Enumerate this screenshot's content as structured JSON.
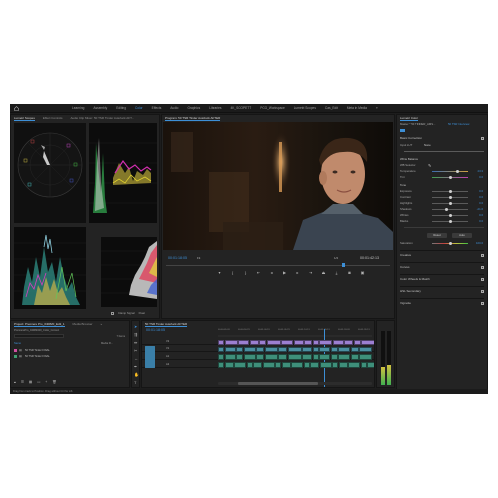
{
  "workspace": {
    "tabs": [
      "Learning",
      "Assembly",
      "Editing",
      "Color",
      "Effects",
      "Audio",
      "Graphics",
      "Libraries",
      "4K_SCOPETT",
      "PCG_Workspace",
      "Lumetri Scopes",
      "Cas_Edit",
      "Meta in Media",
      "»"
    ],
    "active": "Color"
  },
  "scopes_panel": {
    "tabs": [
      "Lumetri Scopes",
      "Effect Controls",
      "Audio Clip Mixer: 50 TSR Tinder Autofuck AFT..."
    ],
    "footer_checkbox": "Clamp Signal",
    "footer_value": "Float"
  },
  "program": {
    "title": "Program: 50 TSR Tinder Autofuck AFTER",
    "timecode_left": "00:01:18:05",
    "fit_label": "Fit",
    "ratio": "1/2",
    "timecode_right": "00:01:42:13"
  },
  "lumetri": {
    "title": "Lumetri Color",
    "master_label": "Master * 50 TINDER_AMS...",
    "master_seq": "50 TSR Interview",
    "basic_correction": "Basic Correction",
    "input_lut_label": "Input LUT",
    "input_lut_value": "None",
    "white_balance": "White Balance",
    "wb_selector": "WB Selector",
    "temperature_label": "Temperature",
    "temperature": "23.3",
    "tint_label": "Tint",
    "tint": "0.0",
    "tone": "Tone",
    "exposure_label": "Exposure",
    "exposure": "0.0",
    "contrast_label": "Contrast",
    "contrast": "0.0",
    "highlights_label": "Highlights",
    "highlights": "0.0",
    "shadows_label": "Shadows",
    "shadows": "-21.0",
    "whites_label": "Whites",
    "whites": "0.0",
    "blacks_label": "Blacks",
    "blacks": "0.0",
    "reset": "Reset",
    "auto": "Auto",
    "saturation_label": "Saturation",
    "saturation": "100.0",
    "sections": [
      "Creative",
      "Curves",
      "Color Wheels & Match",
      "HSL Secondary",
      "Vignette"
    ]
  },
  "project": {
    "tabs": [
      "Project: Premiere Pro_040820_Edit_1",
      "Media Browser",
      "»"
    ],
    "path": "PremierePro_04082020_Color_Correct",
    "count": "7 Items",
    "col_name": "Name",
    "col_rate": "Media Fl...",
    "items": [
      "50 TSR Tinder FINAL",
      "50 TSR Tinder FINAL"
    ]
  },
  "timeline": {
    "tab": "50 TSR Tinder Autofuck AFTER",
    "timecode": "00:01:18:05",
    "ruler": [
      "00:00:45:03",
      "00:00:50:23",
      "00:01:00:19",
      "00:01:05:23",
      "00:01:14:13",
      "00:01:20:13",
      "00:01:24:03",
      "00:01:26:13"
    ],
    "tracks": [
      "V2",
      "V1",
      "A1",
      "A2"
    ]
  },
  "status_bar": "Drag from track to Position. Drag without Ctrl for Lift.",
  "colors": {
    "accent": "#3d8fd6",
    "clip_purple": "#9c7fd1",
    "clip_teal": "#4a8fa0",
    "clip_audio": "#3e8f7a"
  }
}
